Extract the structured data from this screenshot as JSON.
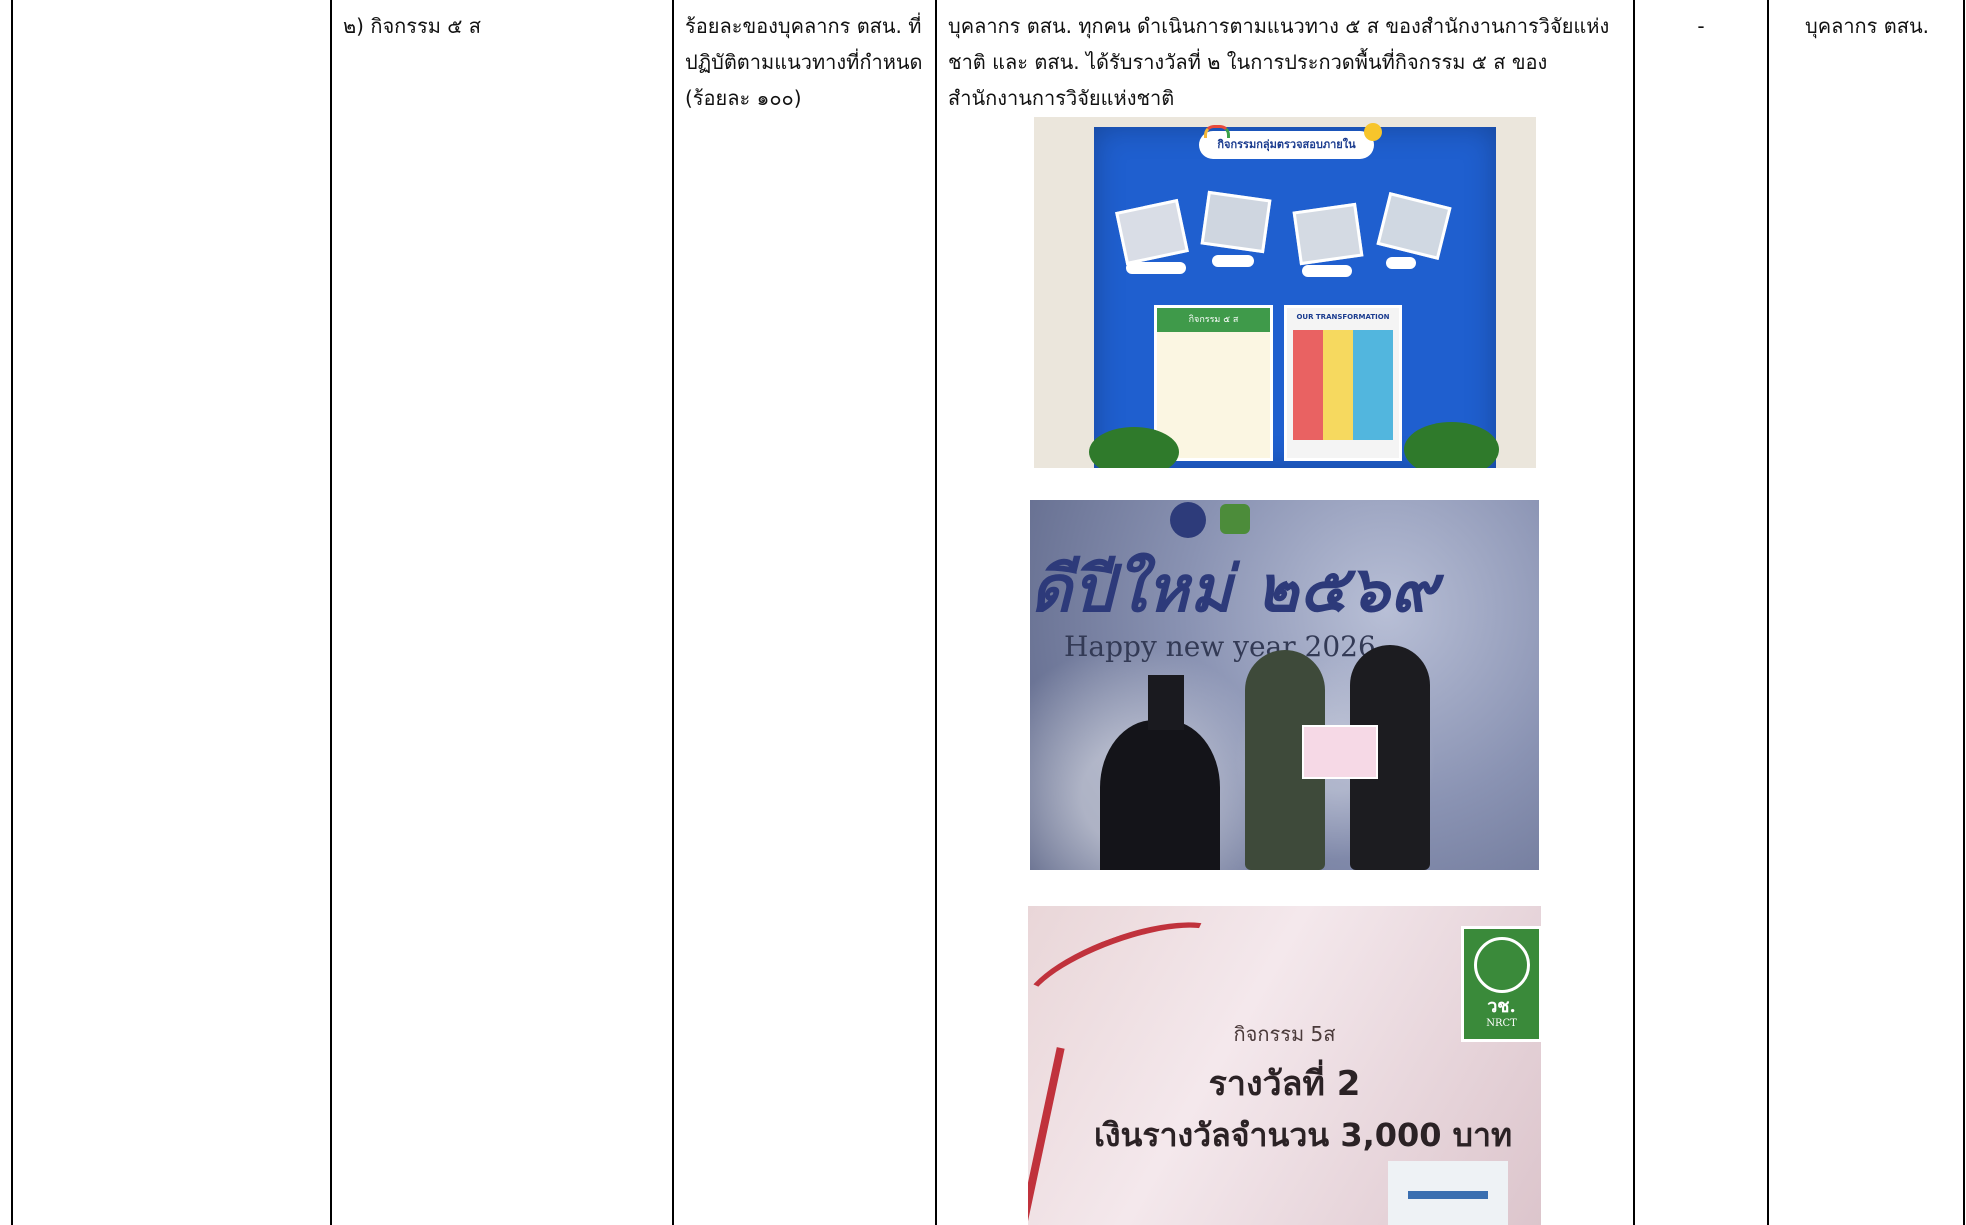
{
  "row": {
    "col2": "๒) กิจกรรม ๕ ส",
    "col3": "ร้อยละของบุคลากร ตสน. ที่ปฏิบัติตามแนวทางที่กำหนด (ร้อยละ ๑๐๐)",
    "col4": "บุคลากร ตสน. ทุกคน ดำเนินการตามแนวทาง ๕ ส ของสำนักงานการวิจัยแห่งชาติ และ ตสน. ได้รับรางวัลที่ ๒ ในการประกวดพื้นที่กิจกรรม ๕ ส ของสำนักงานการวิจัยแห่งชาติ",
    "col5": "-",
    "col6": "บุคลากร ตสน."
  },
  "photo1": {
    "banner": "กิจกรรมกลุ่มตรวจสอบภายใน",
    "left_poster": "กิจกรรม ๕ ส",
    "right_poster": "OUR TRANSFORMATION"
  },
  "photo2": {
    "thai_greeting": "ดีปีใหม่ ๒๕๖๙",
    "english_greeting": "Happy new year 2026"
  },
  "photo3": {
    "line1": "กิจกรรม 5ส",
    "line2": "รางวัลที่ 2",
    "line3": "เงินรางวัลจำนวน 3,000 บาท",
    "logo_text": "วช.",
    "logo_sub": "NRCT"
  }
}
